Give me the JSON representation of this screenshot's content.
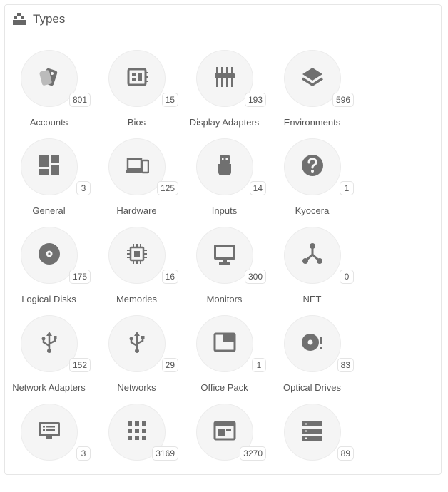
{
  "header": {
    "title": "Types",
    "icon": "boxes-icon"
  },
  "tiles": [
    {
      "label": "Accounts",
      "count": "801",
      "icon": "tags-icon"
    },
    {
      "label": "Bios",
      "count": "15",
      "icon": "chip-board-icon"
    },
    {
      "label": "Display Adapters",
      "count": "193",
      "icon": "adapter-icon"
    },
    {
      "label": "Environments",
      "count": "596",
      "icon": "layers-icon"
    },
    {
      "label": "General",
      "count": "3",
      "icon": "dashboard-icon"
    },
    {
      "label": "Hardware",
      "count": "125",
      "icon": "devices-icon"
    },
    {
      "label": "Inputs",
      "count": "14",
      "icon": "usb-plug-icon"
    },
    {
      "label": "Kyocera",
      "count": "1",
      "icon": "help-icon"
    },
    {
      "label": "Logical Disks",
      "count": "175",
      "icon": "disc-icon"
    },
    {
      "label": "Memories",
      "count": "16",
      "icon": "memory-chip-icon"
    },
    {
      "label": "Monitors",
      "count": "300",
      "icon": "monitor-icon"
    },
    {
      "label": "NET",
      "count": "0",
      "icon": "network-icon"
    },
    {
      "label": "Network Adapters",
      "count": "152",
      "icon": "usb-icon"
    },
    {
      "label": "Networks",
      "count": "29",
      "icon": "usb-icon"
    },
    {
      "label": "Office Pack",
      "count": "1",
      "icon": "window-icon"
    },
    {
      "label": "Optical Drives",
      "count": "83",
      "icon": "disc-alert-icon"
    },
    {
      "label": "",
      "count": "3",
      "icon": "display-list-icon"
    },
    {
      "label": "",
      "count": "3169",
      "icon": "apps-grid-icon"
    },
    {
      "label": "",
      "count": "3270",
      "icon": "web-window-icon"
    },
    {
      "label": "",
      "count": "89",
      "icon": "server-icon"
    }
  ]
}
